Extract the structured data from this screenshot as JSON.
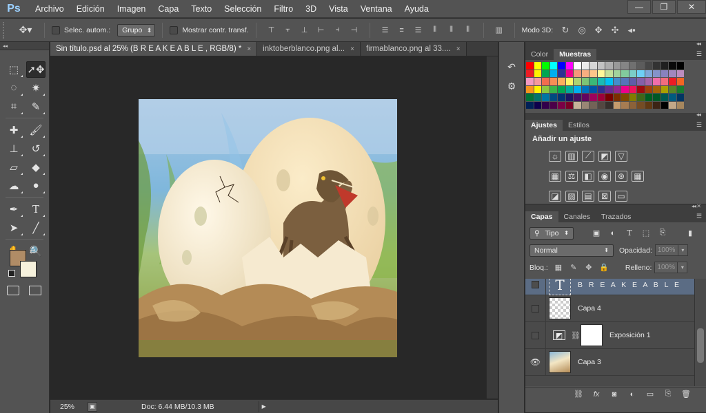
{
  "menu": {
    "logo": "Ps",
    "items": [
      "Archivo",
      "Edición",
      "Imagen",
      "Capa",
      "Texto",
      "Selección",
      "Filtro",
      "3D",
      "Vista",
      "Ventana",
      "Ayuda"
    ],
    "window_controls": {
      "minimize": "—",
      "restore": "❐",
      "close": "✕"
    }
  },
  "options": {
    "auto_select_label": "Selec. autom.:",
    "auto_select_value": "Grupo",
    "show_transform_label": "Mostrar contr. transf.",
    "mode_3d_label": "Modo 3D:"
  },
  "tabs": [
    {
      "label": "Sin título.psd al 25% (B R E A K E A B L E , RGB/8) *",
      "active": true,
      "close": "×"
    },
    {
      "label": "inktoberblanco.png al...",
      "active": false,
      "close": "×"
    },
    {
      "label": "firmablanco.png al 33....",
      "active": false,
      "close": "×"
    }
  ],
  "colors": {
    "foreground": "#b08c66",
    "background": "#f6f1dc",
    "selected_layer": "#5b6c84"
  },
  "status": {
    "zoom": "25%",
    "doc_info": "Doc: 6.44 MB/10.3 MB"
  },
  "panels": {
    "swatches": {
      "tabs": [
        "Color",
        "Muestras"
      ],
      "colors": [
        "#ff0000",
        "#ffff00",
        "#00ff00",
        "#00ffff",
        "#0000ff",
        "#ff00ff",
        "#ffffff",
        "#ebebeb",
        "#d6d6d6",
        "#c2c2c2",
        "#adadad",
        "#999999",
        "#858585",
        "#707070",
        "#5c5c5c",
        "#474747",
        "#333333",
        "#1f1f1f",
        "#0a0a0a",
        "#000000",
        "#ed1c24",
        "#fff200",
        "#00a651",
        "#00aeef",
        "#2e3192",
        "#ec008c",
        "#f7977a",
        "#f9ad81",
        "#fdc68a",
        "#fff79a",
        "#c4df9b",
        "#a2d39c",
        "#82ca9d",
        "#7bcdc8",
        "#6ecff6",
        "#7ea7d8",
        "#8493ca",
        "#8882be",
        "#a187be",
        "#bc8dbf",
        "#f49ac2",
        "#f6989d",
        "#f26c4f",
        "#f68e55",
        "#fbaf5c",
        "#fff467",
        "#acd372",
        "#7cc576",
        "#3bb878",
        "#1abbb4",
        "#00bff3",
        "#438ccb",
        "#5574b9",
        "#605ca8",
        "#855fa8",
        "#a763a8",
        "#f06ea9",
        "#f26d7d",
        "#ed1c24",
        "#f26522",
        "#f7941d",
        "#fff200",
        "#8dc73f",
        "#39b54a",
        "#00a651",
        "#00a99d",
        "#00aeef",
        "#0072bc",
        "#0054a6",
        "#2e3192",
        "#662d91",
        "#92278f",
        "#ec008c",
        "#ed145b",
        "#9e0b0f",
        "#a0410d",
        "#a36209",
        "#aba000",
        "#598527",
        "#1a7b30",
        "#007236",
        "#00746b",
        "#0076a3",
        "#004b80",
        "#003471",
        "#1b1464",
        "#440e62",
        "#630460",
        "#9e005d",
        "#9e0039",
        "#790000",
        "#7b2e00",
        "#7d4900",
        "#827b00",
        "#406618",
        "#005e20",
        "#005826",
        "#005952",
        "#005b7f",
        "#003663",
        "#002157",
        "#0d004c",
        "#32004b",
        "#4b0049",
        "#7b0046",
        "#7a0026",
        "#c7b299",
        "#998675",
        "#736357",
        "#534741",
        "#37302d",
        "#c69c6d",
        "#a67c52",
        "#8c6239",
        "#754c24",
        "#603913",
        "#3c2415",
        "#000000",
        "#c2a888",
        "#a6875e"
      ]
    },
    "adjustments": {
      "tabs": [
        "Ajustes",
        "Estilos"
      ],
      "title": "Añadir un ajuste",
      "row1": [
        {
          "name": "brightness-icon",
          "glyph": "☼"
        },
        {
          "name": "levels-icon",
          "glyph": "▥"
        },
        {
          "name": "curves-icon",
          "glyph": "⟋"
        },
        {
          "name": "exposure-icon",
          "glyph": "◩"
        },
        {
          "name": "gradient-triangle-icon",
          "glyph": "▽"
        }
      ],
      "row2": [
        {
          "name": "vibrance-icon",
          "glyph": "▦"
        },
        {
          "name": "balance-icon",
          "glyph": "⚖"
        },
        {
          "name": "bw-icon",
          "glyph": "◧"
        },
        {
          "name": "photo-filter-icon",
          "glyph": "◉"
        },
        {
          "name": "channel-mixer-icon",
          "glyph": "⊛"
        },
        {
          "name": "color-lookup-icon",
          "glyph": "▦"
        }
      ],
      "row3": [
        {
          "name": "invert-icon",
          "glyph": "◪"
        },
        {
          "name": "posterize-icon",
          "glyph": "▨"
        },
        {
          "name": "threshold-icon",
          "glyph": "▤"
        },
        {
          "name": "selective-color-icon",
          "glyph": "⊠"
        },
        {
          "name": "gradient-map-icon",
          "glyph": "▭"
        }
      ]
    },
    "layers": {
      "tabs": [
        "Capas",
        "Canales",
        "Trazados"
      ],
      "filter_label": "Tipo",
      "blend_mode": "Normal",
      "opacity_label": "Opacidad:",
      "opacity_value": "100%",
      "lock_label": "Bloq.:",
      "fill_label": "Relleno:",
      "fill_value": "100%",
      "items": [
        {
          "name": "B R E A K E A B L E",
          "kind": "text",
          "visible": false,
          "selected": true
        },
        {
          "name": "Capa 4",
          "kind": "empty",
          "visible": false,
          "selected": false
        },
        {
          "name": "Exposición 1",
          "kind": "adjustment",
          "visible": false,
          "selected": false
        },
        {
          "name": "Capa 3",
          "kind": "image",
          "visible": true,
          "selected": false
        }
      ]
    }
  }
}
